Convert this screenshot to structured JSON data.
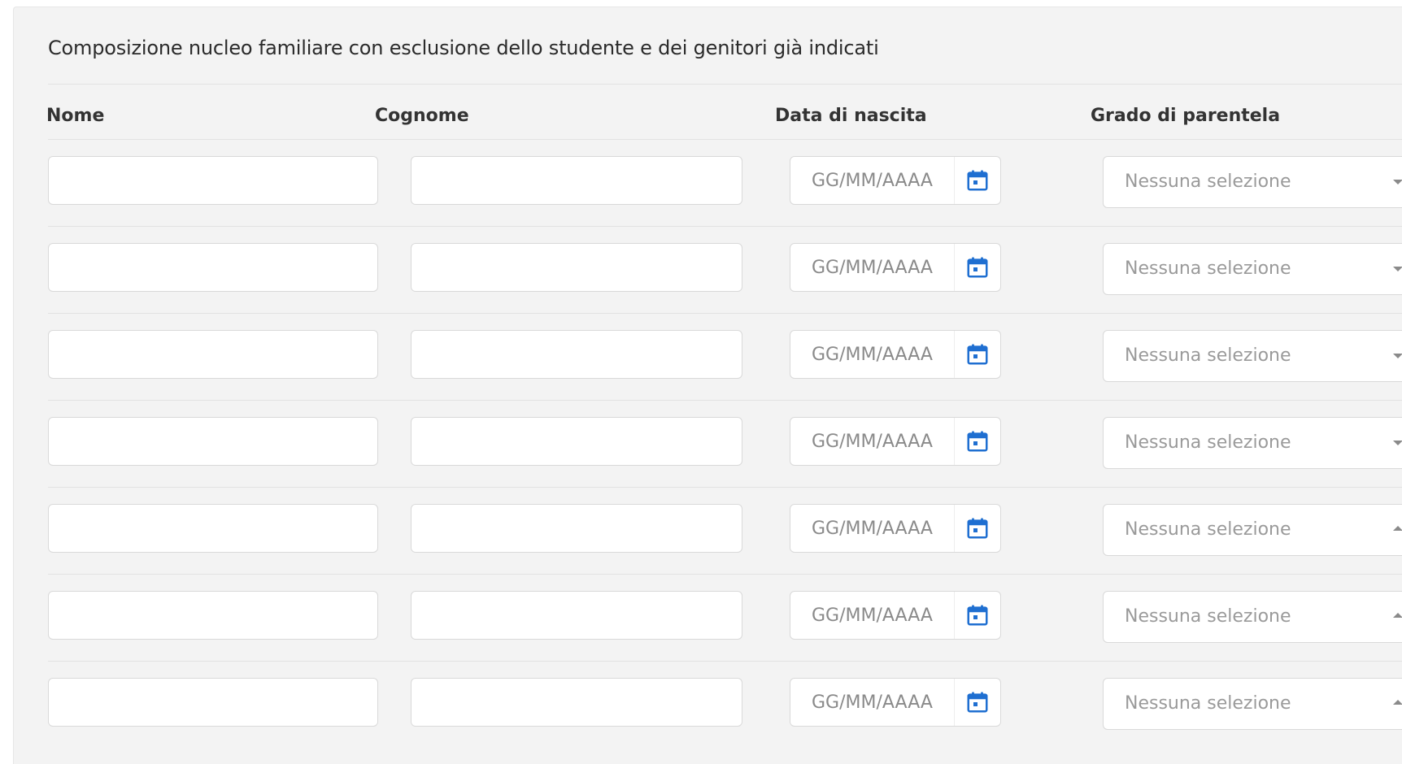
{
  "section": {
    "title": "Composizione nucleo familiare con esclusione dello studente e dei genitori già indicati"
  },
  "columns": {
    "nome": "Nome",
    "cognome": "Cognome",
    "data_nascita": "Data di nascita",
    "grado_parentela": "Grado di parentela"
  },
  "rows": [
    {
      "nome": "",
      "cognome": "",
      "data_placeholder": "GG/MM/AAAA",
      "grado_selected": "Nessuna selezione",
      "dropdown_icon": "caret-down-icon"
    },
    {
      "nome": "",
      "cognome": "",
      "data_placeholder": "GG/MM/AAAA",
      "grado_selected": "Nessuna selezione",
      "dropdown_icon": "caret-down-icon"
    },
    {
      "nome": "",
      "cognome": "",
      "data_placeholder": "GG/MM/AAAA",
      "grado_selected": "Nessuna selezione",
      "dropdown_icon": "caret-down-icon"
    },
    {
      "nome": "",
      "cognome": "",
      "data_placeholder": "GG/MM/AAAA",
      "grado_selected": "Nessuna selezione",
      "dropdown_icon": "caret-down-icon"
    },
    {
      "nome": "",
      "cognome": "",
      "data_placeholder": "GG/MM/AAAA",
      "grado_selected": "Nessuna selezione",
      "dropdown_icon": "caret-up-icon"
    },
    {
      "nome": "",
      "cognome": "",
      "data_placeholder": "GG/MM/AAAA",
      "grado_selected": "Nessuna selezione",
      "dropdown_icon": "caret-up-icon"
    },
    {
      "nome": "",
      "cognome": "",
      "data_placeholder": "GG/MM/AAAA",
      "grado_selected": "Nessuna selezione",
      "dropdown_icon": "caret-up-icon"
    }
  ],
  "icons": {
    "calendar": "calendar-icon"
  },
  "colors": {
    "panel_background": "#f3f3f3",
    "calendar_icon": "#1f6fd1",
    "placeholder_text": "#8a8a8a",
    "select_text": "#9a9a9a"
  }
}
